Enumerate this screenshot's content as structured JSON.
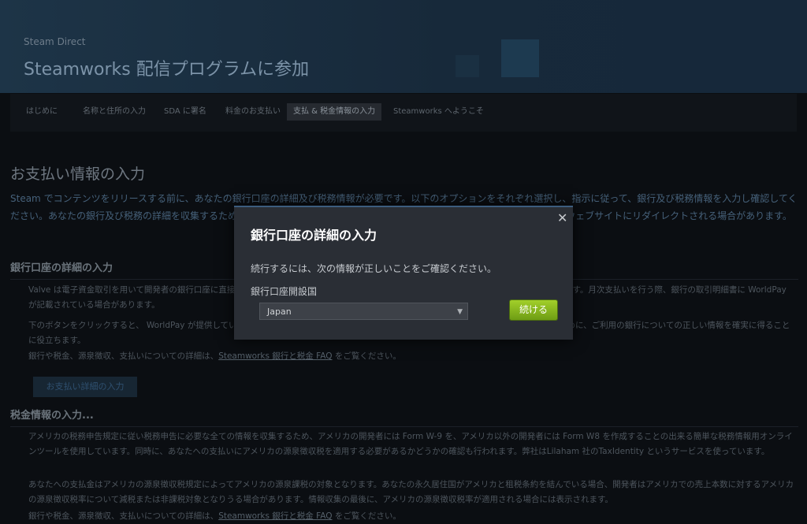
{
  "header": {
    "eyebrow": "Steam Direct",
    "title": "Steamworks 配信プログラムに参加"
  },
  "tabs": [
    {
      "label": "はじめに",
      "active": false
    },
    {
      "label": "名称と住所の入力",
      "active": false
    },
    {
      "label": "SDA に署名",
      "active": false
    },
    {
      "label": "料金のお支払い",
      "active": false
    },
    {
      "label": "支払 & 税金情報の入力",
      "active": true
    },
    {
      "label": "Steamworks へようこそ",
      "active": false
    }
  ],
  "content": {
    "title": "お支払い情報の入力",
    "intro": "Steam でコンテンツをリリースする前に、あなたの銀行口座の詳細及び税務情報が必要です。以下のオプションをそれぞれ選択し、指示に従って、銀行及び税務情報を入力し確認してください。あなたの銀行及び税務の詳細を収集するために、サードパーティを利用しています。この情報の入力プロセス中にこれらのウェブサイトにリダイレクトされる場合があります。",
    "bank_section": {
      "heading": "銀行口座の詳細の入力",
      "para1": "Valve は電子資金取引を用いて開発者の銀行口座に直接支払いを行います。この手続きにおいては、WorldPay が提供しているサービスを利用します。月次支払いを行う際、銀行の取引明細書に WorldPay が記載されている場合があります。",
      "para2": "下のボタンをクリックすると、 WorldPay が提供している、銀行口座の詳細を入力するための画面に移動します。あなたに無事に支払いを行うために、ご利用の銀行についての正しい情報を確実に得ることに役立ちます。",
      "faq_prefix": "銀行や税金、源泉徴収、支払いについての詳細は、",
      "faq_link": "Steamworks 銀行と税金 FAQ",
      "faq_suffix": " をご覧ください。",
      "button_label": "お支払い詳細の入力"
    },
    "tax_section": {
      "heading": "税金情報の入力...",
      "para1": "アメリカの税務申告規定に従い税務申告に必要な全ての情報を収集するため、アメリカの開発者には Form W-9 を、アメリカ以外の開発者には Form W8 を作成することの出来る簡単な税務情報用オンラインツールを使用しています。同時に、あなたへの支払いにアメリカの源泉徴収税を適用する必要があるかどうかの確認も行われます。弊社はLilaham 社のTaxIdentity というサービスを使っています。",
      "para2": "あなたへの支払金はアメリカの源泉徴収税規定によってアメリカの源泉課税の対象となります。あなたの永久居住国がアメリカと租税条約を結んでいる場合、開発者はアメリカでの売上本数に対するアメリカの源泉徴収税率について減税または非課税対象となりうる場合があります。情報収集の最後に、アメリカの源泉徴収税率が適用される場合には表示されます。",
      "faq_prefix": "銀行や税金、源泉徴収、支払いについての詳細は、",
      "faq_link": "Steamworks 銀行と税金 FAQ",
      "faq_suffix": " をご覧ください。"
    }
  },
  "modal": {
    "title": "銀行口座の詳細の入力",
    "close_glyph": "✕",
    "message": "続行するには、次の情報が正しいことをご確認ください。",
    "country_label": "銀行口座開設国",
    "country_value": "Japan",
    "caret_glyph": "▼",
    "continue_label": "続ける"
  },
  "colors": {
    "accent_green": "#a2cf2a",
    "modal_bg": "#2a2e35",
    "modal_border": "#3c5d7e"
  }
}
